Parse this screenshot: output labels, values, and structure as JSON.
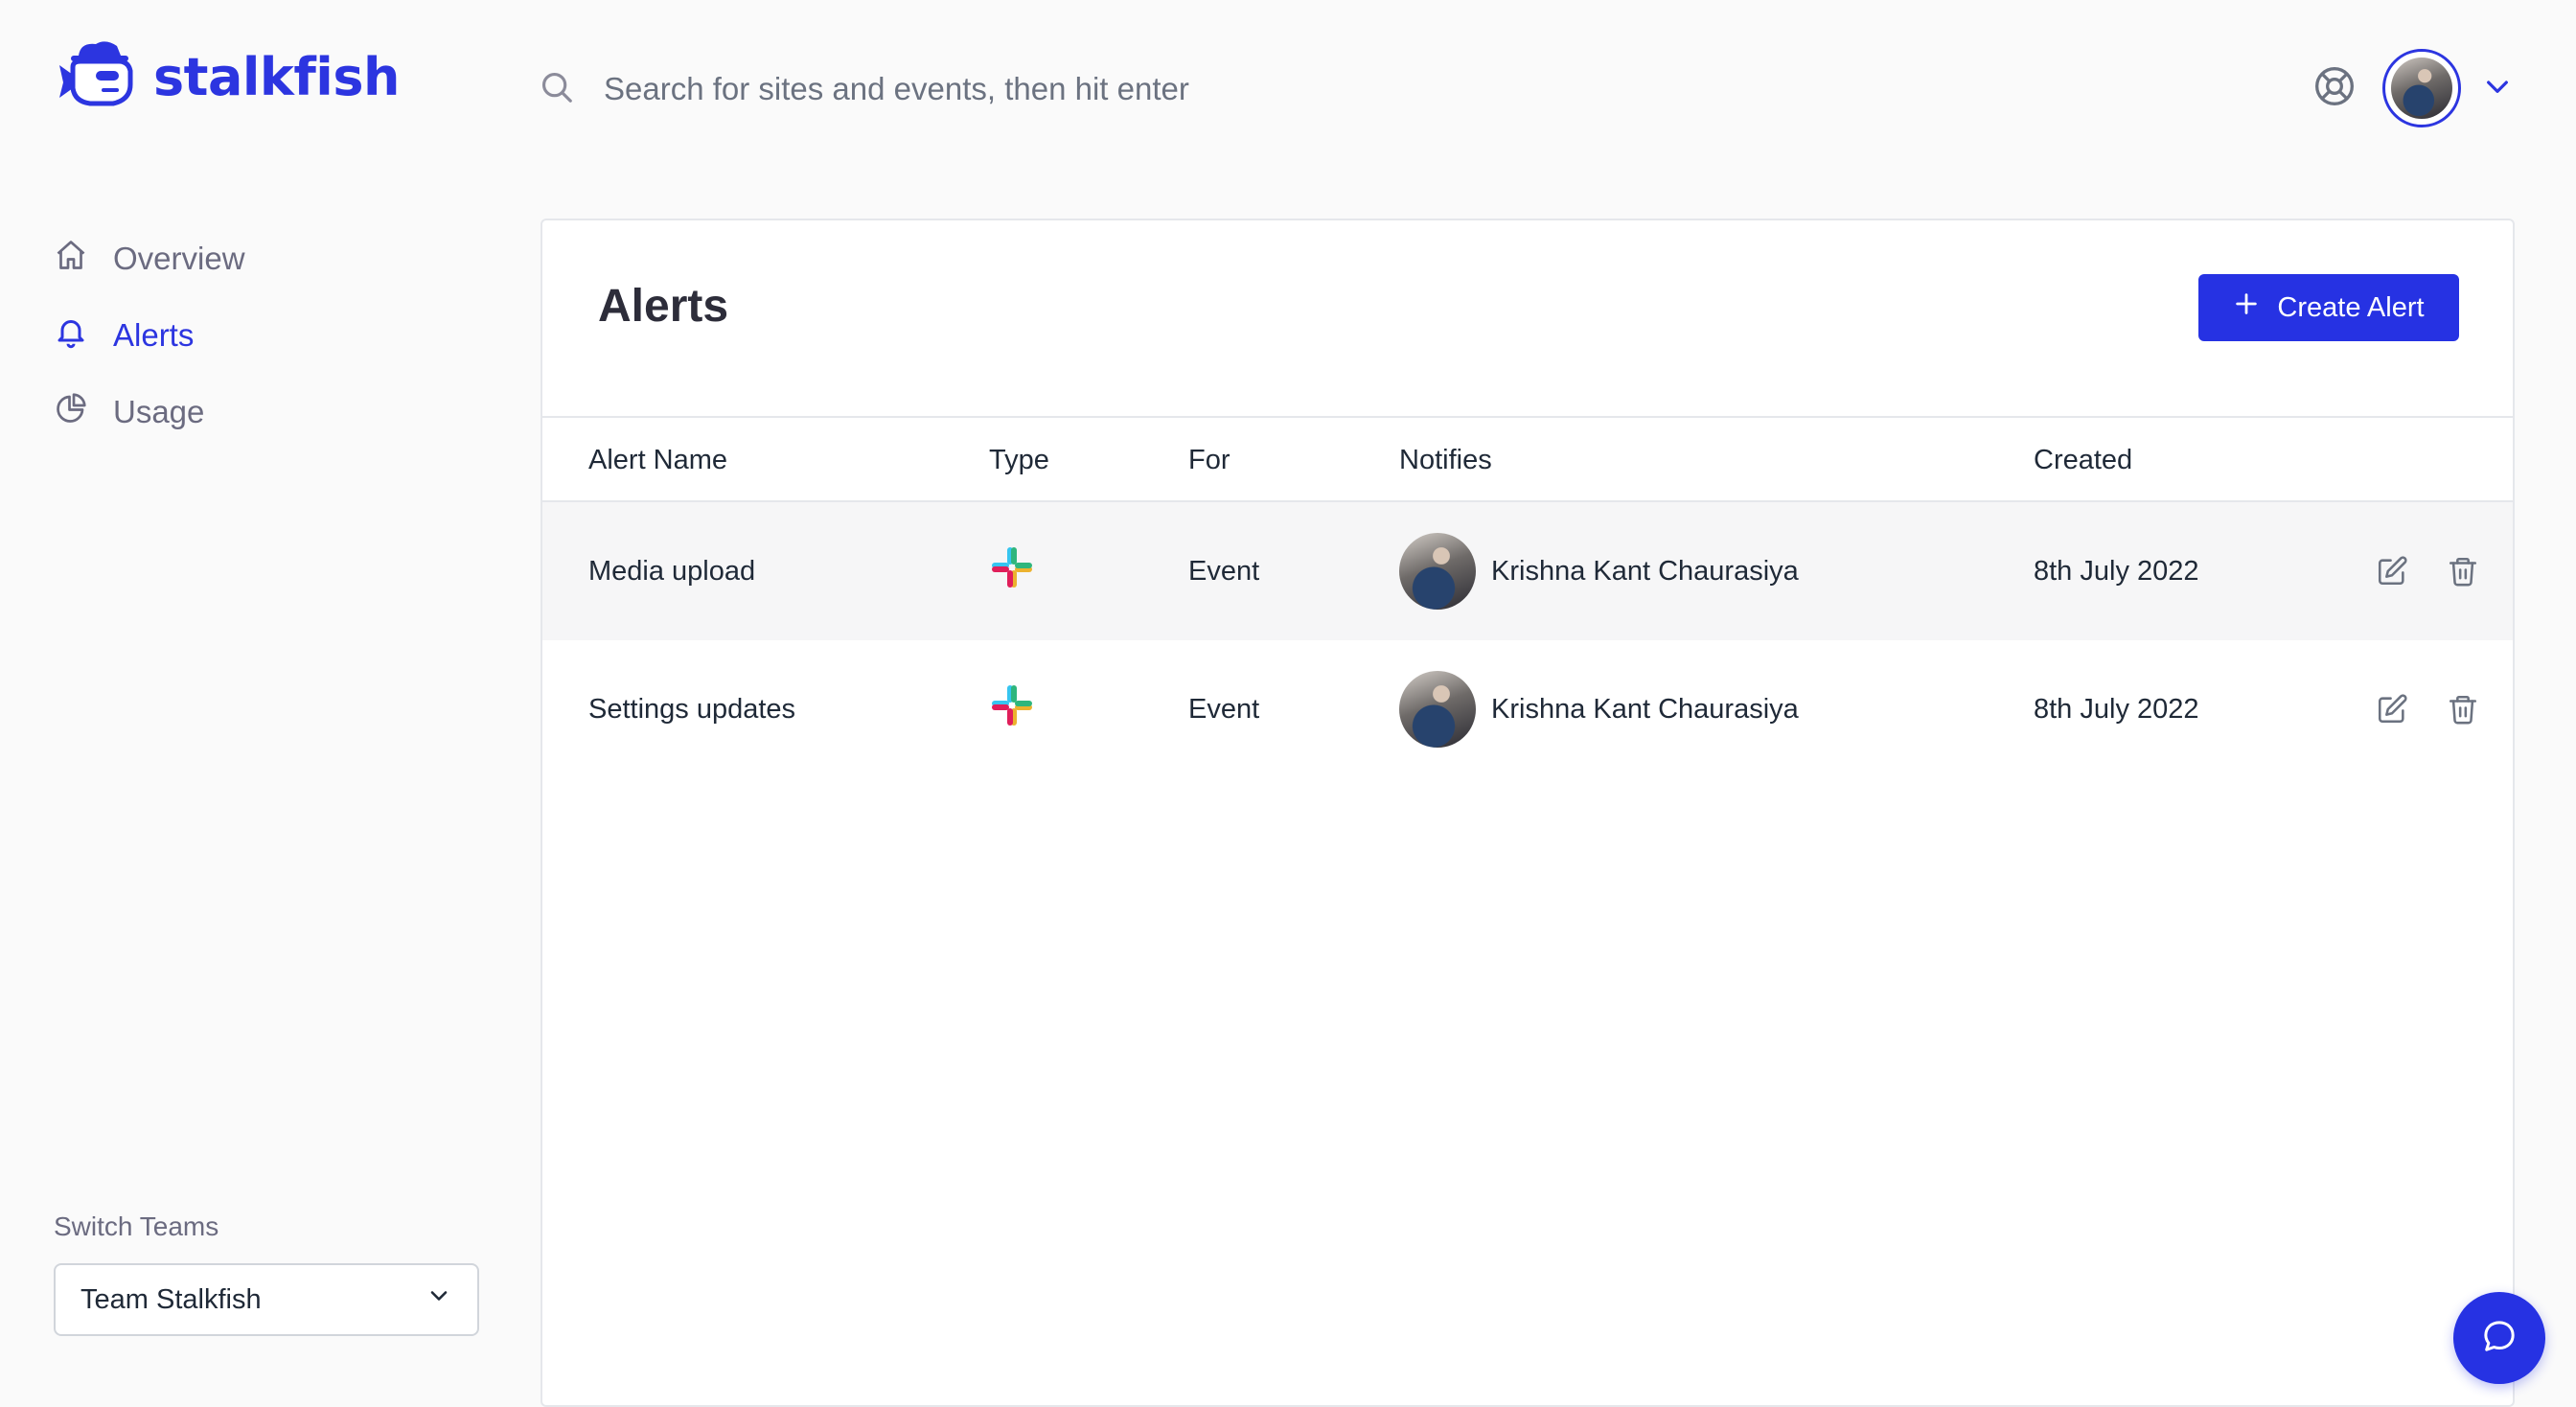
{
  "brand": {
    "name": "stalkfish",
    "logo_icon": "fish-detective-icon",
    "color": "#2c35e0"
  },
  "search": {
    "placeholder": "Search for sites and events, then hit enter",
    "value": ""
  },
  "header": {
    "help_icon": "lifebuoy-icon",
    "user_menu_icon": "chevron-down-icon"
  },
  "sidebar": {
    "items": [
      {
        "label": "Overview",
        "icon": "home-icon",
        "active": false
      },
      {
        "label": "Alerts",
        "icon": "bell-icon",
        "active": true
      },
      {
        "label": "Usage",
        "icon": "pie-chart-icon",
        "active": false
      }
    ],
    "switch_teams_label": "Switch Teams",
    "team_select": {
      "value": "Team Stalkfish"
    }
  },
  "main": {
    "title": "Alerts",
    "create_button_label": "Create Alert",
    "table": {
      "columns": [
        "Alert Name",
        "Type",
        "For",
        "Notifies",
        "Created"
      ],
      "rows": [
        {
          "name": "Media upload",
          "type_icon": "slack-icon",
          "for": "Event",
          "notifies": "Krishna Kant Chaurasiya",
          "created": "8th July 2022"
        },
        {
          "name": "Settings updates",
          "type_icon": "slack-icon",
          "for": "Event",
          "notifies": "Krishna Kant Chaurasiya",
          "created": "8th July 2022"
        }
      ]
    }
  },
  "colors": {
    "accent": "#2632e3",
    "row_highlight": "#f6f6f7",
    "muted_text": "#6b6b80"
  }
}
